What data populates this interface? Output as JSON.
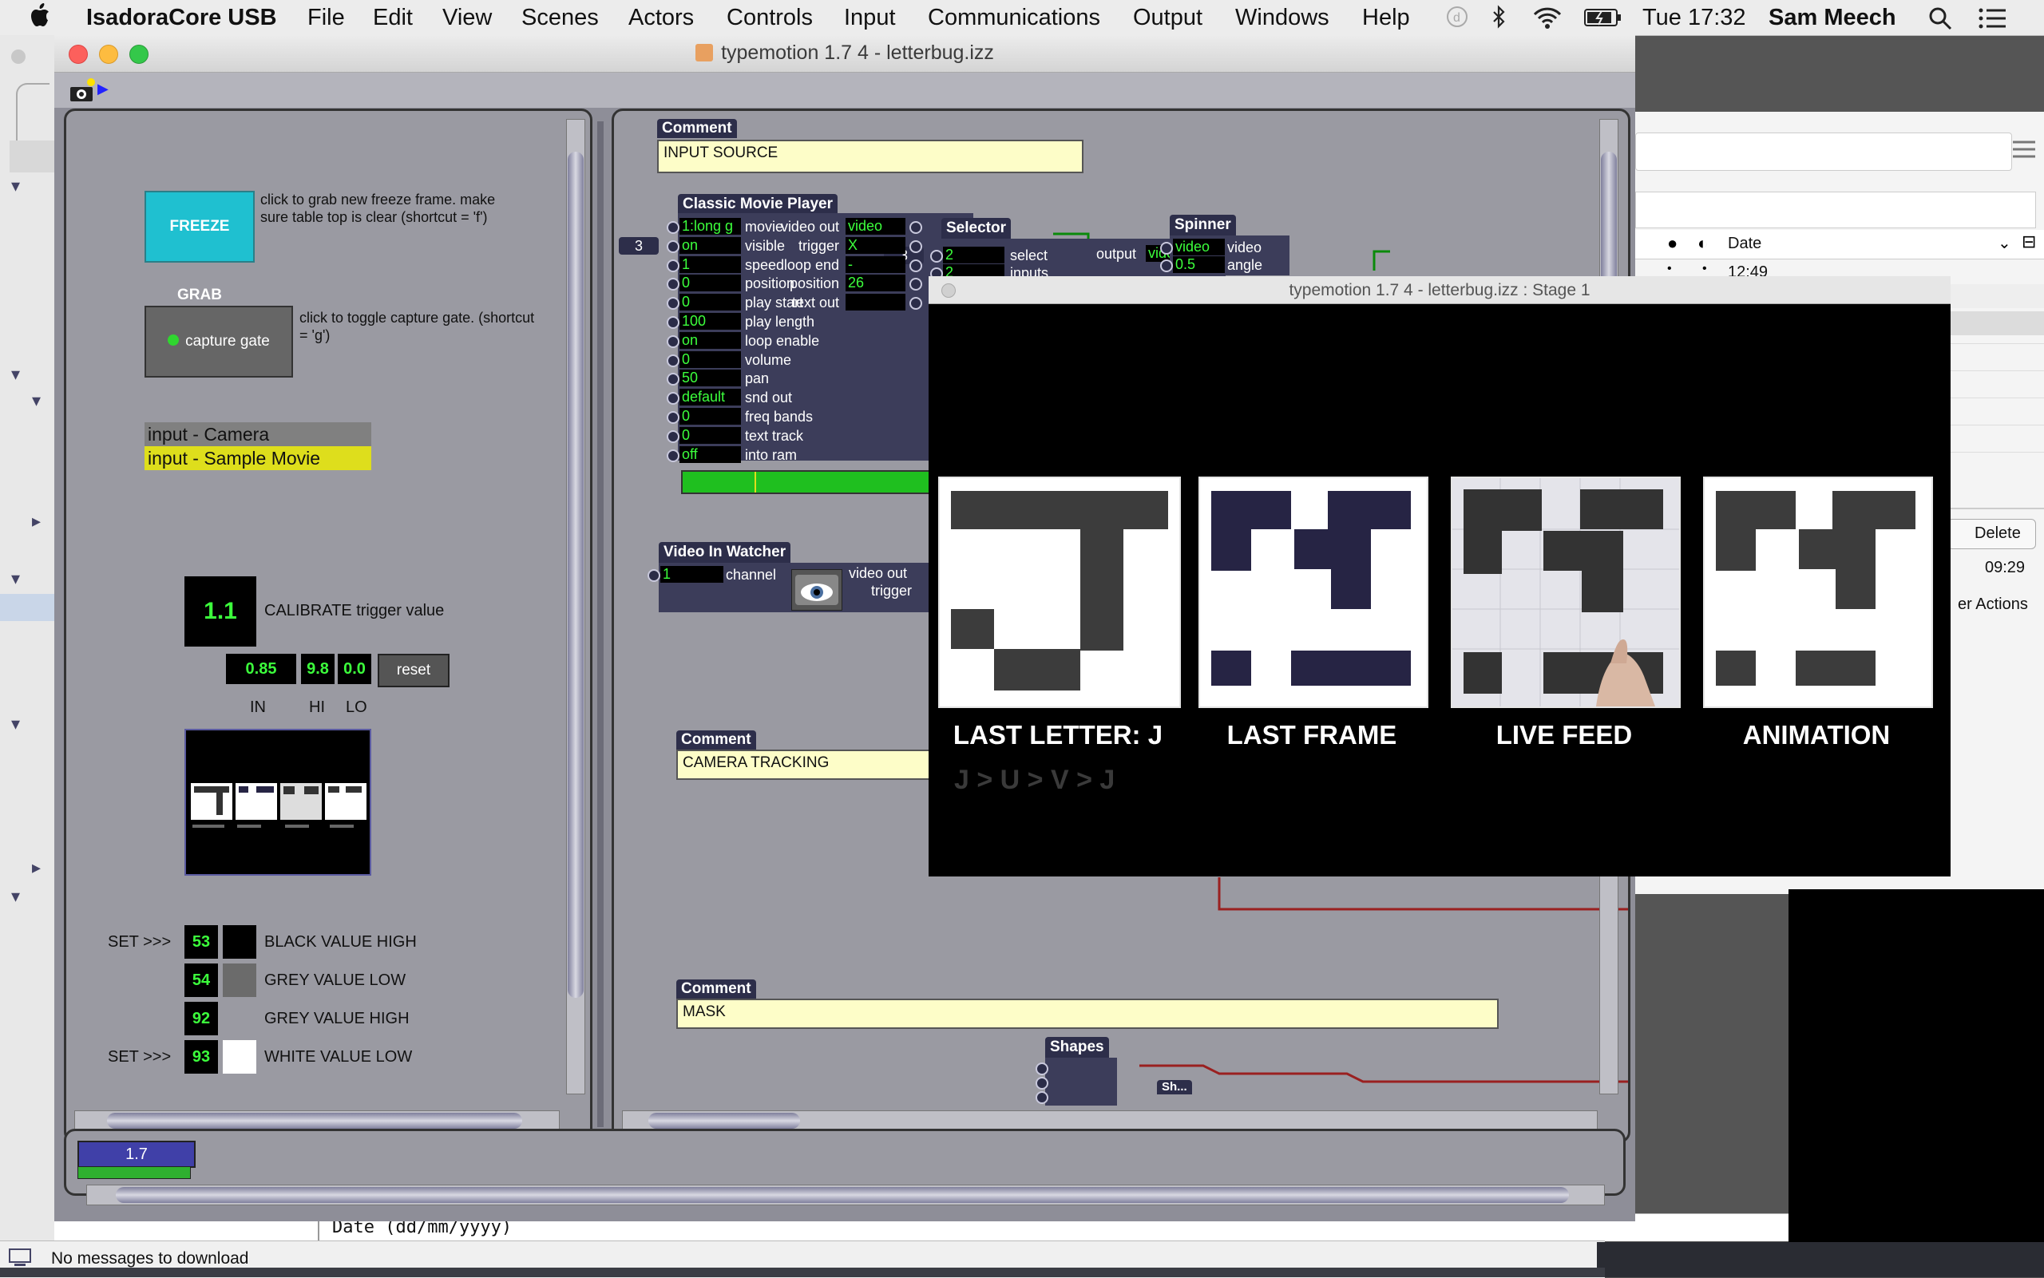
{
  "menubar": {
    "app": "IsadoraCore USB",
    "items": [
      "File",
      "Edit",
      "View",
      "Scenes",
      "Actors",
      "Controls",
      "Input",
      "Communications",
      "Output",
      "Windows",
      "Help"
    ],
    "clock": "Tue 17:32",
    "user": "Sam Meech"
  },
  "window": {
    "title": "typemotion 1.7 4 - letterbug.izz"
  },
  "controls": {
    "freeze_label": "FREEZE GRAB",
    "freeze_help": "click to grab new freeze frame. make sure table top is clear (shortcut = 'f')",
    "capture_label": "capture gate",
    "capture_help": "click to toggle capture gate. (shortcut = 'g')",
    "inputs": [
      "input - Camera",
      "input - Sample Movie"
    ],
    "calibrate_value": "1.1",
    "calibrate_label": "CALIBRATE trigger value",
    "in_value": "0.85",
    "hi_value": "9.8",
    "lo_value": "0.0",
    "reset_label": "reset",
    "in_label": "IN",
    "hi_label": "HI",
    "lo_label": "LO",
    "thresholds": [
      {
        "set": "SET >>>",
        "value": "53",
        "label": "BLACK VALUE HIGH",
        "swatch": "#000000"
      },
      {
        "set": "",
        "value": "54",
        "label": "GREY VALUE LOW",
        "swatch": "#6b6b6b"
      },
      {
        "set": "",
        "value": "92",
        "label": "GREY VALUE HIGH",
        "swatch": "#9a9aa2"
      },
      {
        "set": "SET >>>",
        "value": "93",
        "label": "WHITE VALUE LOW",
        "swatch": "#ffffff"
      }
    ],
    "version_value": "1.7"
  },
  "patch": {
    "comment1_title": "Comment",
    "comment1": "INPUT SOURCE",
    "comment2_title": "Comment",
    "comment2": "CAMERA TRACKING",
    "comment3_title": "Comment",
    "comment3": "MASK",
    "player_title": "Classic Movie Player",
    "player_inputs": [
      {
        "v": "1:long g",
        "n": "movie"
      },
      {
        "v": "on",
        "n": "visible"
      },
      {
        "v": "1",
        "n": "speed"
      },
      {
        "v": "0",
        "n": "position"
      },
      {
        "v": "0",
        "n": "play start"
      },
      {
        "v": "100",
        "n": "play length"
      },
      {
        "v": "on",
        "n": "loop enable"
      },
      {
        "v": "0",
        "n": "volume"
      },
      {
        "v": "50",
        "n": "pan"
      },
      {
        "v": "default",
        "n": "snd out"
      },
      {
        "v": "0",
        "n": "freq bands"
      },
      {
        "v": "0",
        "n": "text track"
      },
      {
        "v": "off",
        "n": "into ram"
      }
    ],
    "player_outputs": [
      {
        "n": "video out",
        "v": "video"
      },
      {
        "n": "trigger",
        "v": "X"
      },
      {
        "n": "loop end",
        "v": "-"
      },
      {
        "n": "position",
        "v": "26"
      },
      {
        "n": "text out",
        "v": ""
      }
    ],
    "player_badge": "3",
    "selector_title": "Selector",
    "selector_badge": "3",
    "selector_in": [
      {
        "v": "2",
        "n": "select"
      },
      {
        "v": "2",
        "n": "inputs"
      }
    ],
    "selector_out_name": "output",
    "selector_out_val": "video",
    "spinner_title": "Spinner",
    "spinner_in": [
      {
        "v": "video",
        "n": "video"
      },
      {
        "v": "0.5",
        "n": "angle"
      }
    ],
    "watcher_title": "Video In Watcher",
    "watcher_in_val": "1",
    "watcher_in_name": "channel",
    "watcher_out1": "video out",
    "watcher_out2": "trigger",
    "shapes_title": "Shapes",
    "shapes2_title": "Sh..."
  },
  "stage": {
    "title": "typemotion 1.7 4 - letterbug.izz : Stage 1",
    "labels": [
      "LAST LETTER:  J",
      "LAST FRAME",
      "LIVE FEED",
      "ANIMATION"
    ],
    "history": "J > U > V > J"
  },
  "background": {
    "date_col": "Date",
    "time1": "12:49",
    "time2": "09:29",
    "delete": "Delete",
    "actions": "er Actions",
    "date_field": "Date (dd/mm/yyyy)",
    "status": "No messages to download"
  }
}
